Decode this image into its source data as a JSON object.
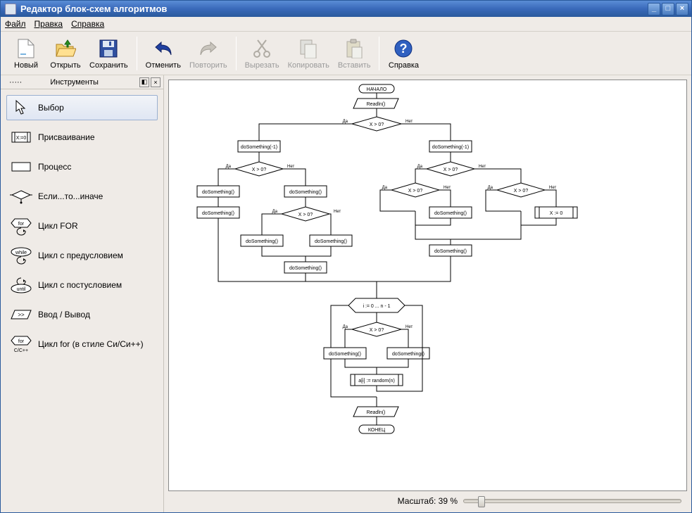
{
  "window": {
    "title": "Редактор блок-схем алгоритмов"
  },
  "menu": {
    "file": "Файл",
    "edit": "Правка",
    "help": "Справка"
  },
  "toolbar": {
    "new": "Новый",
    "open": "Открыть",
    "save": "Сохранить",
    "undo": "Отменить",
    "redo": "Повторить",
    "cut": "Вырезать",
    "copy": "Копировать",
    "paste": "Вставить",
    "help": "Справка"
  },
  "tools_panel": {
    "title": "Инструменты"
  },
  "tools": [
    {
      "id": "select",
      "label": "Выбор",
      "selected": true
    },
    {
      "id": "assign",
      "label": "Присваивание"
    },
    {
      "id": "process",
      "label": "Процесс"
    },
    {
      "id": "ifelse",
      "label": "Если...то...иначе"
    },
    {
      "id": "for",
      "label": "Цикл FOR"
    },
    {
      "id": "while",
      "label": "Цикл с предусловием"
    },
    {
      "id": "until",
      "label": "Цикл с постусловием"
    },
    {
      "id": "io",
      "label": "Ввод / Вывод"
    },
    {
      "id": "cfor",
      "label": "Цикл for (в стиле Си/Си++)"
    }
  ],
  "status": {
    "zoom_label": "Масштаб: 39 %",
    "zoom_value": 39
  },
  "flow_labels": {
    "yes": "Да",
    "no": "Нет"
  },
  "chart_data": {
    "type": "flowchart",
    "nodes": [
      {
        "id": "start",
        "type": "terminator",
        "text": "НАЧАЛО"
      },
      {
        "id": "in1",
        "type": "io",
        "text": "Readln()"
      },
      {
        "id": "d1",
        "type": "decision",
        "text": "X > 0?"
      },
      {
        "id": "p1",
        "type": "process",
        "text": "doSomething(-1)"
      },
      {
        "id": "p2",
        "type": "process",
        "text": "doSomething(-1)"
      },
      {
        "id": "d2",
        "type": "decision",
        "text": "X > 0?"
      },
      {
        "id": "d3",
        "type": "decision",
        "text": "X > 0?"
      },
      {
        "id": "p3",
        "type": "process",
        "text": "doSomething()"
      },
      {
        "id": "p4",
        "type": "process",
        "text": "doSomething()"
      },
      {
        "id": "p5",
        "type": "process",
        "text": "doSomething()"
      },
      {
        "id": "d4",
        "type": "decision",
        "text": "X > 0?"
      },
      {
        "id": "p6",
        "type": "process",
        "text": "doSomething()"
      },
      {
        "id": "p7",
        "type": "process",
        "text": "doSomething()"
      },
      {
        "id": "p8",
        "type": "process",
        "text": "doSomething()"
      },
      {
        "id": "d5",
        "type": "decision",
        "text": "X > 0?"
      },
      {
        "id": "d6",
        "type": "decision",
        "text": "X > 0?"
      },
      {
        "id": "p9",
        "type": "process",
        "text": "doSomething()"
      },
      {
        "id": "a1",
        "type": "assign",
        "text": "X := 0"
      },
      {
        "id": "p10",
        "type": "process",
        "text": "doSomething()"
      },
      {
        "id": "for1",
        "type": "for",
        "text": "i := 0 ... n - 1"
      },
      {
        "id": "d7",
        "type": "decision",
        "text": "X > 0?"
      },
      {
        "id": "p11",
        "type": "process",
        "text": "doSomething()"
      },
      {
        "id": "p12",
        "type": "process",
        "text": "doSomething()"
      },
      {
        "id": "a2",
        "type": "assign",
        "text": "a[i] := random(n)"
      },
      {
        "id": "out1",
        "type": "io",
        "text": "Readln()"
      },
      {
        "id": "end",
        "type": "terminator",
        "text": "КОНЕЦ"
      }
    ]
  }
}
